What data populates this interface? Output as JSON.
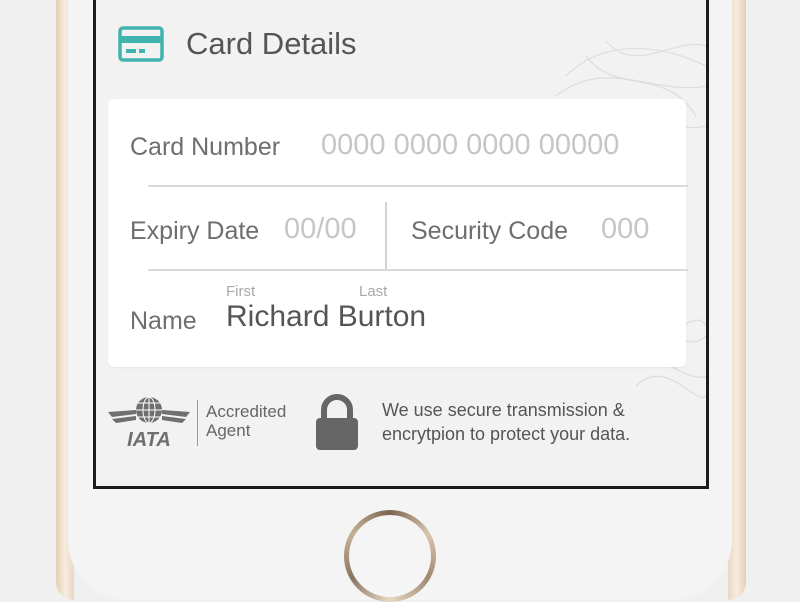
{
  "header": {
    "title": "Card Details",
    "icon": "credit-card-icon",
    "accent_color": "#3fb3ad"
  },
  "form": {
    "card_number": {
      "label": "Card Number",
      "placeholder": "0000 0000 0000 00000"
    },
    "expiry_date": {
      "label": "Expiry Date",
      "placeholder": "00/00"
    },
    "security_code": {
      "label": "Security Code",
      "placeholder": "000"
    },
    "name": {
      "label": "Name",
      "first_hint": "First",
      "last_hint": "Last",
      "value": "Richard Burton"
    }
  },
  "footer": {
    "iata": {
      "logo_text": "IATA",
      "accredited_line1": "Accredited",
      "accredited_line2": "Agent"
    },
    "lock_icon": "lock-icon",
    "security_message": "We use secure transmission & encrytpion to protect your data."
  },
  "device": {
    "home_button": "home-button"
  }
}
